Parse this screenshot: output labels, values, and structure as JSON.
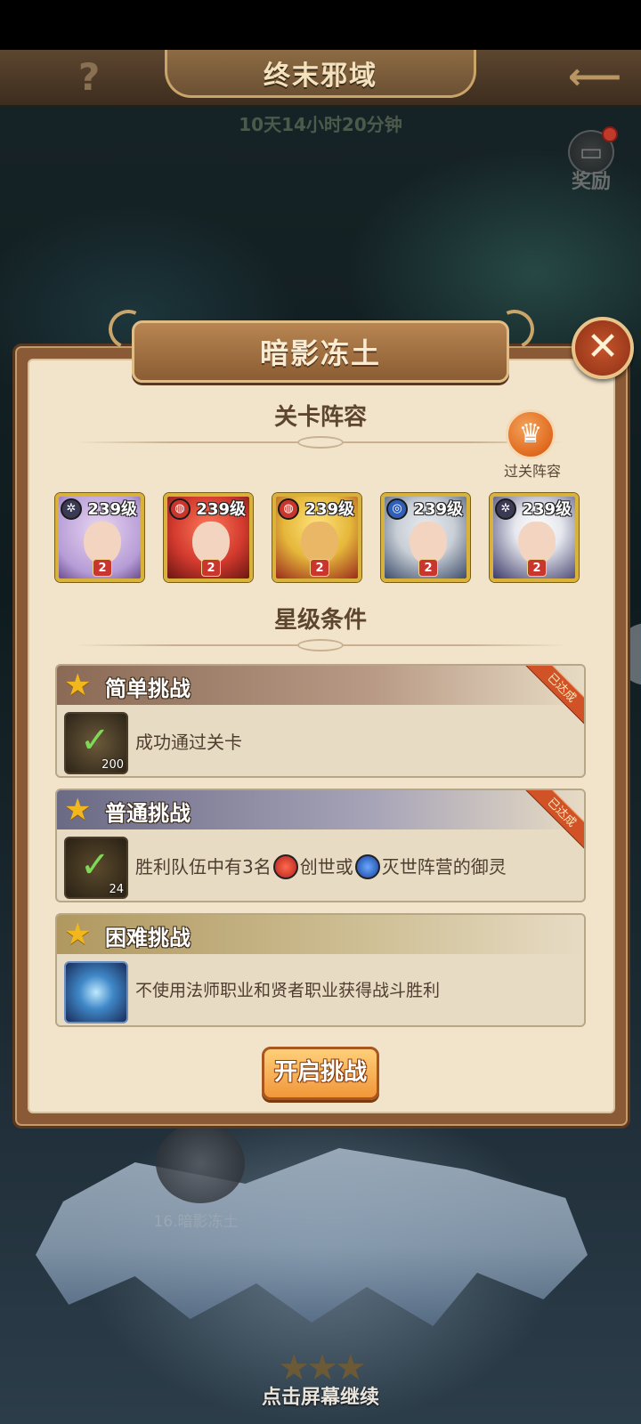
{
  "top_bar": {
    "title": "终末邪域",
    "help_icon": "?",
    "back_icon": "back-arrow-icon"
  },
  "timer": "10天14小时20分钟",
  "reward": {
    "label": "奖励",
    "icon": "reward-book-icon",
    "has_notification": true
  },
  "dialog": {
    "title": "暗影冻土",
    "close_icon": "close-icon",
    "lineup_heading": "关卡阵容",
    "clear_lineup_label": "过关阵容",
    "clear_lineup_icon": "crown-icon",
    "heroes": [
      {
        "level": "239级",
        "stars": "2",
        "faction": "dark",
        "faction_color": "#3a3a55",
        "hair": "#d8b7e6",
        "bg": "#b69cd6"
      },
      {
        "level": "239级",
        "stars": "2",
        "faction": "creation",
        "faction_color": "#c8362d",
        "hair": "#d23a2e",
        "bg": "#8b2320"
      },
      {
        "level": "239级",
        "stars": "2",
        "faction": "creation",
        "faction_color": "#c8362d",
        "hair": "#e5b73a",
        "bg": "#9b2b1d"
      },
      {
        "level": "239级",
        "stars": "2",
        "faction": "destruction",
        "faction_color": "#2f5fb8",
        "hair": "#c9cfd6",
        "bg": "#3d4d6b"
      },
      {
        "level": "239级",
        "stars": "2",
        "faction": "dark",
        "faction_color": "#3a3a55",
        "hair": "#e6e8ee",
        "bg": "#3d3a6a"
      }
    ],
    "star_heading": "星级条件",
    "challenges": [
      {
        "title": "简单挑战",
        "desc": "成功通过关卡",
        "count": "200",
        "completed": true,
        "badge": "已达成",
        "head_color": "#8a6a55"
      },
      {
        "title": "普通挑战",
        "desc_parts": [
          "胜利队伍中有3名",
          "创世或",
          "灭世阵营的御灵"
        ],
        "count": "24",
        "completed": true,
        "badge": "已达成",
        "head_color": "#6b6a85"
      },
      {
        "title": "困难挑战",
        "desc": "不使用法师职业和贤者职业获得战斗胜利",
        "completed": false,
        "head_color": "#b09860"
      }
    ],
    "start_button": "开启挑战"
  },
  "map": {
    "level_node_label": "16.暗影冻土"
  },
  "continue_text": "点击屏幕继续"
}
